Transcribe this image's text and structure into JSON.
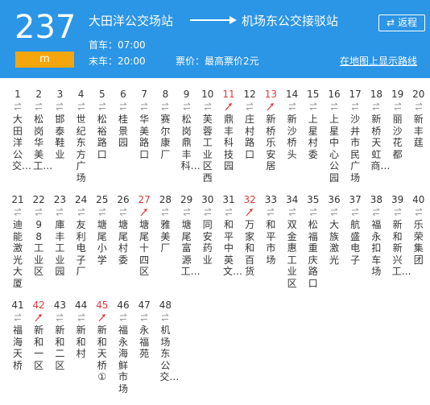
{
  "header": {
    "route_number": "237",
    "unit": "m",
    "origin": "大田洋公交场站",
    "destination": "机场东公交接驳站",
    "return_label": "返程",
    "first_bus": "首车：07:00",
    "last_bus": "末车：20:00",
    "fare": "票价：最高票价2元",
    "map_link": "在地图上显示路线"
  },
  "colors": {
    "header_bg": "#2b95e6",
    "badge": "#f5a60c",
    "highlight_stop": "#e03c3c"
  },
  "stops": [
    {
      "num": "1",
      "name": "大田洋公交…",
      "dir": "both"
    },
    {
      "num": "2",
      "name": "松岗华美工…",
      "dir": "both"
    },
    {
      "num": "3",
      "name": "邯泰鞋业",
      "dir": "both"
    },
    {
      "num": "4",
      "name": "世纪东方广场",
      "dir": "both"
    },
    {
      "num": "5",
      "name": "松裕路口",
      "dir": "both"
    },
    {
      "num": "6",
      "name": "桂景园",
      "dir": "both"
    },
    {
      "num": "7",
      "name": "华美路口",
      "dir": "both"
    },
    {
      "num": "8",
      "name": "赛尔康厂",
      "dir": "both"
    },
    {
      "num": "9",
      "name": "松岗鼎丰科…",
      "dir": "both"
    },
    {
      "num": "10",
      "name": "芙蓉工业区西",
      "dir": "both"
    },
    {
      "num": "11",
      "name": "鼎丰科技园",
      "dir": "one"
    },
    {
      "num": "12",
      "name": "庄村路口",
      "dir": "both"
    },
    {
      "num": "13",
      "name": "新桥乐安居",
      "dir": "one"
    },
    {
      "num": "14",
      "name": "新沙桥头",
      "dir": "both"
    },
    {
      "num": "15",
      "name": "上星村委",
      "dir": "both"
    },
    {
      "num": "16",
      "name": "上星中心公园",
      "dir": "both"
    },
    {
      "num": "17",
      "name": "沙井市民广场",
      "dir": "both"
    },
    {
      "num": "18",
      "name": "新桥天虹商…",
      "dir": "both"
    },
    {
      "num": "19",
      "name": "丽沙花都",
      "dir": "both"
    },
    {
      "num": "20",
      "name": "新丰莛",
      "dir": "both"
    },
    {
      "num": "21",
      "name": "迪能激光大厦",
      "dir": "both"
    },
    {
      "num": "22",
      "name": "98工业区",
      "dir": "both"
    },
    {
      "num": "23",
      "name": "庫丰工业园",
      "dir": "both"
    },
    {
      "num": "24",
      "name": "友利电子厂",
      "dir": "both"
    },
    {
      "num": "25",
      "name": "塘尾小学",
      "dir": "both"
    },
    {
      "num": "26",
      "name": "塘尾村委",
      "dir": "both"
    },
    {
      "num": "27",
      "name": "塘尾十四区",
      "dir": "one"
    },
    {
      "num": "28",
      "name": "雅美厂",
      "dir": "both"
    },
    {
      "num": "29",
      "name": "塘尾富源工…",
      "dir": "both"
    },
    {
      "num": "30",
      "name": "同安药业",
      "dir": "both"
    },
    {
      "num": "31",
      "name": "和平中英文…",
      "dir": "both"
    },
    {
      "num": "32",
      "name": "万家和百货",
      "dir": "one"
    },
    {
      "num": "33",
      "name": "和平市场",
      "dir": "both"
    },
    {
      "num": "34",
      "name": "双金惠工业区",
      "dir": "both"
    },
    {
      "num": "35",
      "name": "松福重庆路口",
      "dir": "both"
    },
    {
      "num": "36",
      "name": "大族激光",
      "dir": "both"
    },
    {
      "num": "37",
      "name": "航盛电子",
      "dir": "both"
    },
    {
      "num": "38",
      "name": "福永扣车场",
      "dir": "both"
    },
    {
      "num": "39",
      "name": "新和新兴工…",
      "dir": "both"
    },
    {
      "num": "40",
      "name": "乐荣集团",
      "dir": "both"
    },
    {
      "num": "41",
      "name": "福海天桥",
      "dir": "both"
    },
    {
      "num": "42",
      "name": "新和一区",
      "dir": "one"
    },
    {
      "num": "43",
      "name": "新和二区",
      "dir": "both"
    },
    {
      "num": "44",
      "name": "新和村",
      "dir": "both"
    },
    {
      "num": "45",
      "name": "新和天桥①",
      "dir": "one"
    },
    {
      "num": "46",
      "name": "福永海鲜市场",
      "dir": "both"
    },
    {
      "num": "47",
      "name": "永福苑",
      "dir": "both"
    },
    {
      "num": "48",
      "name": "机场东公交…",
      "dir": "both"
    }
  ]
}
